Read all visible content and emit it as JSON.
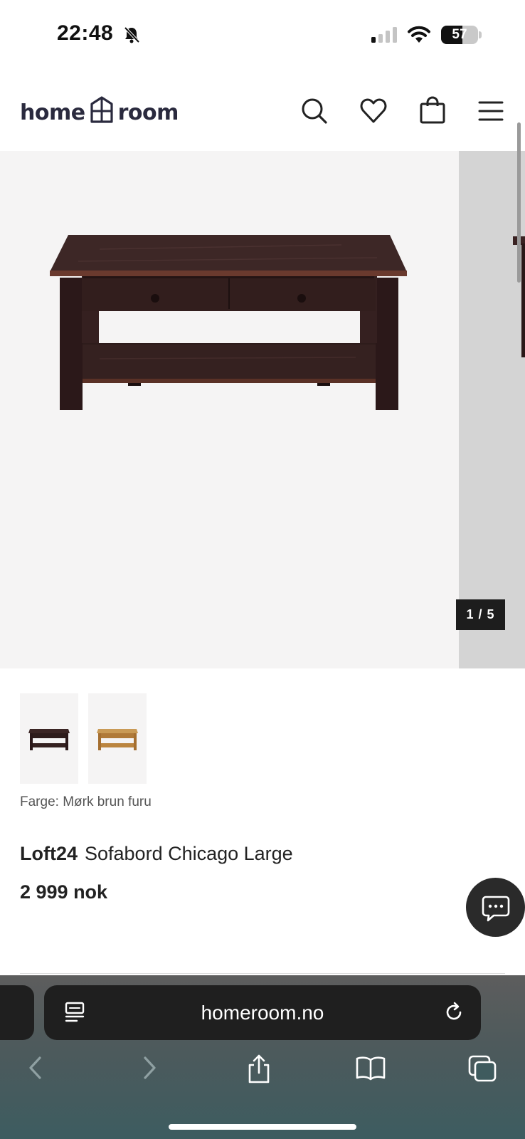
{
  "status_bar": {
    "time": "22:48",
    "battery_level": "57",
    "battery_fraction": 0.57,
    "icons": [
      "bell-slash-icon",
      "signal-icon",
      "wifi-icon",
      "battery-icon"
    ]
  },
  "header": {
    "logo_left": "home",
    "logo_right": "room",
    "icons": [
      "search-icon",
      "heart-icon",
      "bag-icon",
      "menu-icon"
    ]
  },
  "gallery": {
    "counter": "1 / 5",
    "current_index": 1,
    "total": 5
  },
  "variants": {
    "label": "Farge: Mørk brun furu",
    "thumbs": [
      "dark-brown",
      "natural-pine"
    ]
  },
  "product": {
    "brand": "Loft24",
    "name": "Sofabord Chicago Large",
    "price": "2 999 nok"
  },
  "browser": {
    "url": "homeroom.no",
    "toolbar_icons": [
      "back-icon",
      "forward-icon",
      "share-icon",
      "bookmarks-icon",
      "tabs-icon"
    ]
  },
  "colors": {
    "brand_dark": "#2a2a3e",
    "table_dark": "#3b2524",
    "table_natural": "#c08a45",
    "gallery_bg": "#f5f4f4",
    "chat_bg": "#2a2a2a"
  }
}
